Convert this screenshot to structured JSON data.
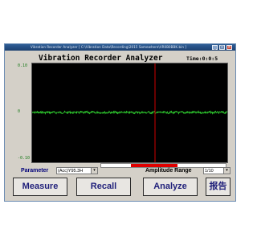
{
  "window": {
    "title": "Vibration Recorder Analyzer [ C:\\Vibration Data\\Recording\\2015 Somewhere\\VR0B0BBK.bin ]"
  },
  "app": {
    "heading": "Vibration Recorder Analyzer",
    "time_label": "Time:0:0:5"
  },
  "plot": {
    "y_labels": [
      "0.10",
      "0",
      "-0.10"
    ],
    "trace_color": "#2fd12f",
    "marker_color": "#d00000",
    "background": "#000000"
  },
  "controls": {
    "parameter_label": "Parameter",
    "parameter_value": "(Acc)Y95.3H",
    "amplitude_label": "Amplitude Range",
    "amplitude_value": "1/10",
    "status_progress": 0.62
  },
  "buttons": {
    "measure": "Measure",
    "recall": "Recall",
    "analyze": "Analyze",
    "report": "报告"
  },
  "colors": {
    "window_bg": "#d4d0c8",
    "button_text": "#1f1f7a",
    "title_bar": "#1c3f70"
  }
}
